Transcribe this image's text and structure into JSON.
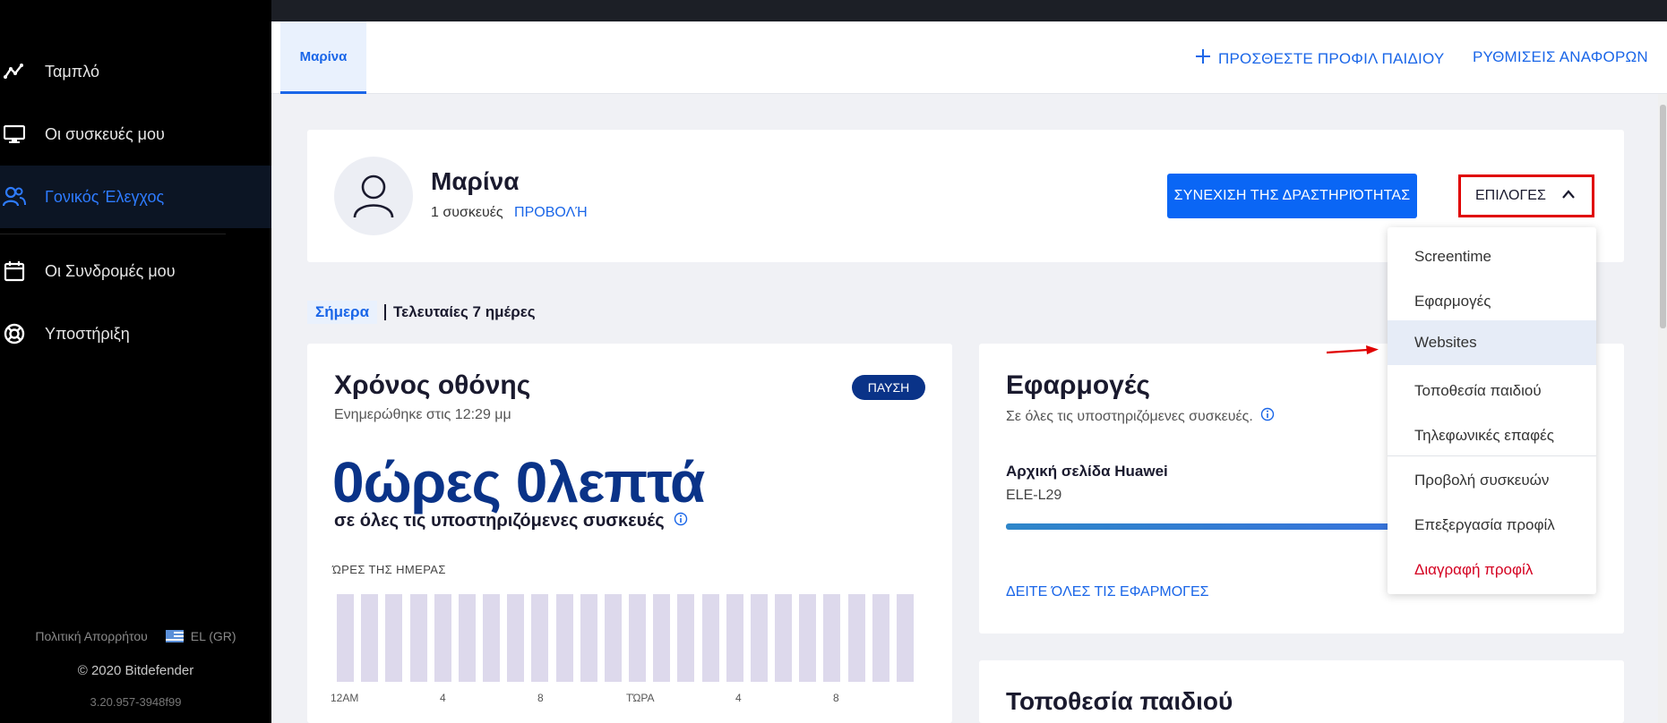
{
  "sidebar": {
    "items": [
      {
        "label": "Ταμπλό",
        "icon": "dashboard-line-icon"
      },
      {
        "label": "Οι συσκευές μου",
        "icon": "monitor-icon"
      },
      {
        "label": "Γονικός Έλεγχος",
        "icon": "users-icon",
        "active": true
      },
      {
        "label": "Οι Συνδρομές μου",
        "icon": "calendar-icon"
      },
      {
        "label": "Υποστήριξη",
        "icon": "lifebuoy-icon"
      }
    ],
    "footer": {
      "privacy": "Πολιτική Απορρήτου",
      "language": "EL (GR)",
      "copyright": "© 2020 Bitdefender",
      "version": "3.20.957-3948f99"
    }
  },
  "header": {
    "active_tab": "Μαρίνα",
    "add_child": "ΠΡΟΣΘΕΣΤΕ ΠΡΟΦΙΛ ΠΑΙΔΙΟΥ",
    "report_settings": "ΡΥΘΜΙΣΕΙΣ ΑΝΑΦΟΡΩΝ"
  },
  "profile": {
    "name": "Μαρίνα",
    "devices": "1 συσκευές",
    "view_link": "ΠΡΟΒΟΛΉ",
    "resume_button": "ΣΥΝΕΧΙΣΗ ΤΗΣ ΔΡΑΣΤΗΡΙΌΤΗΤΑΣ",
    "options_button": "ΕΠΙΛΟΓΕΣ"
  },
  "period": {
    "today": "Σήμερα",
    "last7": "Τελευταίες 7 ημέρες"
  },
  "screen_time": {
    "title": "Χρόνος οθόνης",
    "updated": "Ενημερώθηκε στις 12:29 μμ",
    "badge": "ΠΑΥΣΗ",
    "total": "0ώρες 0λεπτά",
    "total_sub": "σε όλες τις υποστηριζόμενες συσκευές",
    "hours_label": "ΏΡΕΣ ΤΗΣ ΗΜΕΡΑΣ",
    "ticks": [
      "12AM",
      "4",
      "8",
      "ΤΏΡΑ",
      "4",
      "8"
    ],
    "bar_count": 24,
    "bar_color": "#ddd9ec"
  },
  "apps": {
    "title": "Εφαρμογές",
    "sub": "Σε όλες τις υποστηριζόμενες συσκευές.",
    "app_name": "Αρχική σελίδα Huawei",
    "app_model": "ELE-L29",
    "see_all": "ΔΕΙΤΕ ΌΛΕΣ ΤΙΣ ΕΦΑΡΜΟΓΕΣ"
  },
  "location": {
    "title": "Τοποθεσία παιδιού"
  },
  "dropdown": {
    "items": [
      "Screentime",
      "Εφαρμογές",
      "Websites",
      "Τοποθεσία παιδιού",
      "Τηλεφωνικές επαφές",
      "Προβολή συσκευών",
      "Επεξεργασία προφίλ",
      "Διαγραφή προφίλ"
    ],
    "highlighted": "Websites",
    "danger_color": "#d40020"
  },
  "colors": {
    "accent": "#1a66e8",
    "primary_button": "#0a66f5",
    "navy": "#0a3388",
    "highlight_border": "#e00000"
  }
}
